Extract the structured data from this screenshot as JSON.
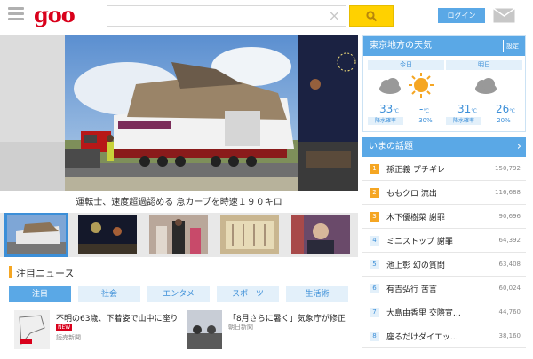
{
  "header": {
    "logo": "goo",
    "search_placeholder": "",
    "search_clear": "×",
    "login_label": "ログイン"
  },
  "hero": {
    "caption": "運転士、速度超過認める 急カーブを時速１９０キロ"
  },
  "news": {
    "section_title": "注目ニュース",
    "tabs": [
      {
        "label": "注目"
      },
      {
        "label": "社会"
      },
      {
        "label": "エンタメ"
      },
      {
        "label": "スポーツ"
      },
      {
        "label": "生活術"
      }
    ],
    "articles": [
      {
        "headline": "不明の63歳、下着姿で山中に座り",
        "source": "読売新聞",
        "badge": "NEW"
      },
      {
        "headline": "「8月さらに暑く」気象庁が修正",
        "source": "朝日新聞"
      }
    ]
  },
  "weather": {
    "title": "東京地方の天気",
    "settings_label": "設定",
    "days": [
      {
        "label": "今日",
        "hi": "33",
        "lo": "-",
        "unit": "℃",
        "rain_label": "降水確率",
        "rain": "30%"
      },
      {
        "label": "明日",
        "hi": "31",
        "lo": "26",
        "unit": "℃",
        "rain_label": "降水確率",
        "rain": "20%"
      }
    ]
  },
  "topics": {
    "title": "いまの話題",
    "items": [
      {
        "rank": "1",
        "title": "孫正義 プチギレ",
        "count": "150,792"
      },
      {
        "rank": "2",
        "title": "ももクロ 流出",
        "count": "116,688"
      },
      {
        "rank": "3",
        "title": "木下優樹菜 謝罪",
        "count": "90,696"
      },
      {
        "rank": "4",
        "title": "ミニストップ 謝罪",
        "count": "64,392"
      },
      {
        "rank": "5",
        "title": "池上彰 幻の質問",
        "count": "63,408"
      },
      {
        "rank": "6",
        "title": "有吉弘行 苦言",
        "count": "60,024"
      },
      {
        "rank": "7",
        "title": "大島由香里 交際宣…",
        "count": "44,760"
      },
      {
        "rank": "8",
        "title": "座るだけダイエッ…",
        "count": "38,160"
      }
    ]
  },
  "colors": {
    "brand": "#d9001b",
    "accent": "#5aa8e6",
    "search_button": "#ffd100",
    "rank_highlight": "#f5a623"
  }
}
